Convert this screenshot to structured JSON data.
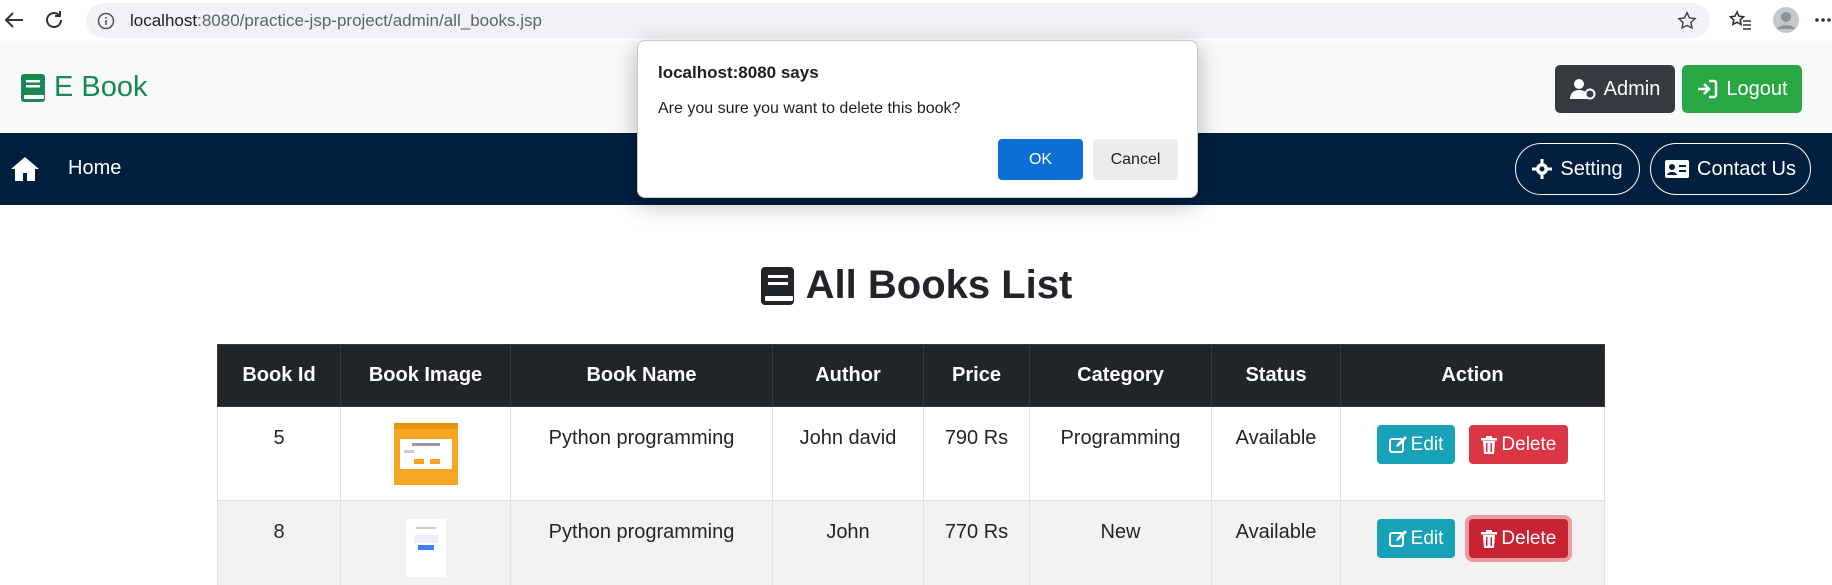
{
  "browser": {
    "url_host": "localhost",
    "url_path": ":8080/practice-jsp-project/admin/all_books.jsp"
  },
  "header": {
    "brand": "E Book",
    "admin_label": "Admin",
    "logout_label": "Logout"
  },
  "navbar": {
    "home_label": "Home",
    "setting_label": "Setting",
    "contact_label": "Contact Us"
  },
  "page": {
    "title": "All Books List"
  },
  "table": {
    "headers": [
      "Book Id",
      "Book Image",
      "Book Name",
      "Author",
      "Price",
      "Category",
      "Status",
      "Action"
    ],
    "rows": [
      {
        "id": "5",
        "name": "Python programming",
        "author": "John david",
        "price": "790 Rs",
        "category": "Programming",
        "status": "Available",
        "edit": "Edit",
        "delete": "Delete"
      },
      {
        "id": "8",
        "name": "Python programming",
        "author": "John",
        "price": "770 Rs",
        "category": "New",
        "status": "Available",
        "edit": "Edit",
        "delete": "Delete"
      }
    ]
  },
  "dialog": {
    "title": "localhost:8080 says",
    "message": "Are you sure you want to delete this book?",
    "ok_label": "OK",
    "cancel_label": "Cancel"
  },
  "colors": {
    "brand": "#198754",
    "navbar": "#001f3f",
    "edit": "#17a2b8",
    "delete": "#dc3545",
    "ok": "#0b6fd6"
  }
}
